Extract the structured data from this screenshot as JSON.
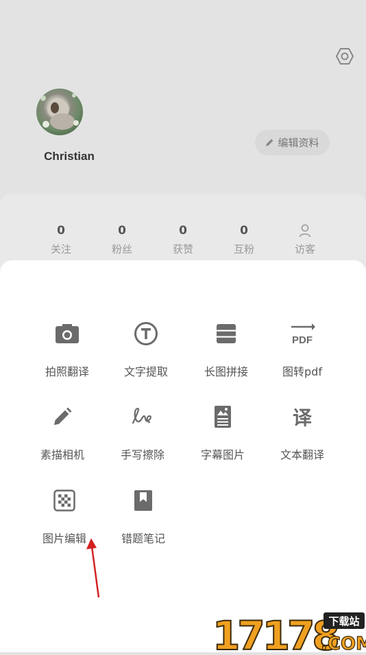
{
  "profile": {
    "username": "Christian",
    "edit_label": "编辑资料"
  },
  "stats": [
    {
      "value": "0",
      "label": "关注"
    },
    {
      "value": "0",
      "label": "粉丝"
    },
    {
      "value": "0",
      "label": "获赞"
    },
    {
      "value": "0",
      "label": "互粉"
    },
    {
      "label": "访客",
      "icon": "person-outline-icon"
    }
  ],
  "tools": [
    {
      "label": "拍照翻译",
      "icon": "camera-icon"
    },
    {
      "label": "文字提取",
      "icon": "text-circle-icon"
    },
    {
      "label": "长图拼接",
      "icon": "stack-icon"
    },
    {
      "label": "图转pdf",
      "icon": "pdf-icon",
      "icon_text": "PDF"
    },
    {
      "label": "素描相机",
      "icon": "pencil-icon"
    },
    {
      "label": "手写擦除",
      "icon": "handwriting-icon"
    },
    {
      "label": "字幕图片",
      "icon": "subtitle-image-icon"
    },
    {
      "label": "文本翻译",
      "icon": "translate-icon",
      "icon_text": "译"
    },
    {
      "label": "图片编辑",
      "icon": "checker-image-icon"
    },
    {
      "label": "错题笔记",
      "icon": "bookmark-icon"
    }
  ],
  "watermark": {
    "brand": "17178",
    "sub": "下载站",
    "domain": ".COM"
  },
  "colors": {
    "icon": "#6b6b6b",
    "background": "#e3e3e3",
    "sheet": "#ffffff",
    "arrow": "#d42020",
    "watermark_orange": "#f0a020"
  }
}
